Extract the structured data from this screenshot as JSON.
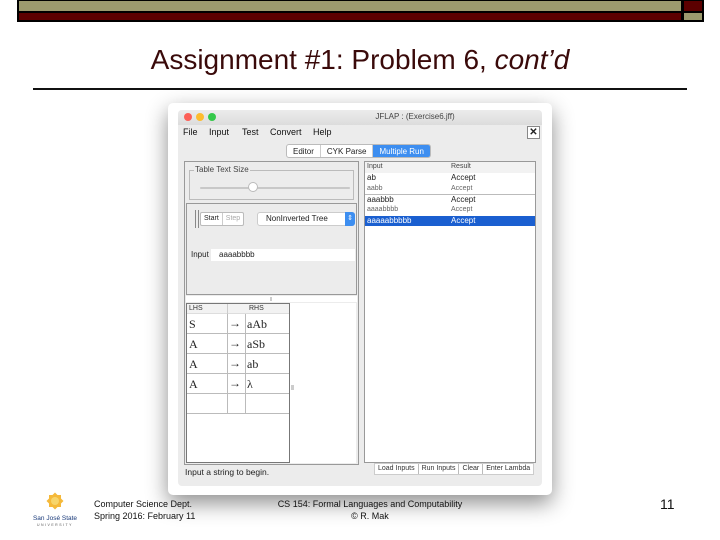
{
  "theme": {
    "band_olive": "#9c9a6e",
    "band_red": "#5c0000",
    "title_color": "#3a0a0a",
    "accent_blue": "#3d8ef0",
    "selection_blue": "#1a5fd0"
  },
  "slide": {
    "title_main": "Assignment #1: Problem 6, ",
    "title_italic": "cont’d",
    "page_number": "11"
  },
  "footer": {
    "logo_name": "San José State",
    "logo_sub": "UNIVERSITY",
    "dept_line1": "Computer Science Dept.",
    "dept_line2": "Spring 2016: February 11",
    "course_line1": "CS 154: Formal Languages and Computability",
    "course_line2": "© R. Mak"
  },
  "window": {
    "title": "JFLAP : (Exercise6.jff)",
    "menu": [
      "File",
      "Input",
      "Test",
      "Convert",
      "Help"
    ],
    "close_label": "✕",
    "tabs": [
      {
        "label": "Editor",
        "active": false
      },
      {
        "label": "CYK Parse",
        "active": false
      },
      {
        "label": "Multiple Run",
        "active": true
      }
    ],
    "table_text_size": {
      "legend": "Table Text Size",
      "slider_value_fraction": 0.35
    },
    "run_controls": {
      "start_label": "Start",
      "step_label": "Step",
      "mode_selected": "NonInverted Tree",
      "select_arrow": "⇕",
      "input_label": "Input",
      "input_value": "aaaabbbb"
    },
    "grammar": {
      "headers": {
        "lhs": "LHS",
        "rhs": "RHS"
      },
      "rows": [
        {
          "lhs": "S",
          "arrow": "→",
          "rhs": "aAb"
        },
        {
          "lhs": "A",
          "arrow": "→",
          "rhs": "aSb"
        },
        {
          "lhs": "A",
          "arrow": "→",
          "rhs": "ab"
        },
        {
          "lhs": "A",
          "arrow": "→",
          "rhs": "λ"
        },
        {
          "lhs": "",
          "arrow": "",
          "rhs": ""
        }
      ]
    },
    "status": "Input a string to begin.",
    "results": {
      "headers": {
        "input": "Input",
        "result": "Result"
      },
      "rows": [
        {
          "input": "ab",
          "result": "Accept",
          "style": "normal"
        },
        {
          "input": "aabb",
          "result": "Accept",
          "style": "dim"
        },
        {
          "input": "aaabbb",
          "result": "Accept",
          "style": "normal"
        },
        {
          "input": "aaaabbbb",
          "result": "Accept",
          "style": "dim"
        },
        {
          "input": "aaaaabbbbb",
          "result": "Accept",
          "style": "selected"
        }
      ],
      "buttons": [
        "Load Inputs",
        "Run Inputs",
        "Clear",
        "Enter Lambda"
      ]
    }
  }
}
